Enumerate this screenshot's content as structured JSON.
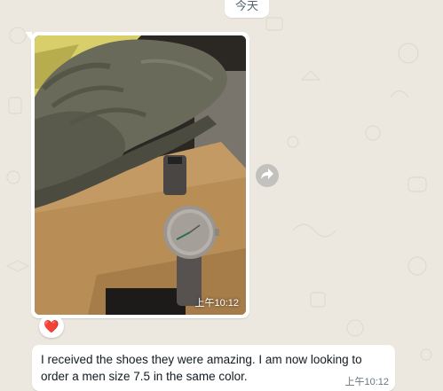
{
  "theme": {
    "chat_background": "#ece8df",
    "bubble": "#ffffff",
    "reaction_heart": "#e0245e"
  },
  "date_chip": {
    "label": "今天"
  },
  "image_message": {
    "time": "上午10:12",
    "reaction": "❤️",
    "forward_icon": "forward-icon",
    "image_description_icon": "photo-shoes-and-watch"
  },
  "text_message": {
    "text": "I received the shoes they were amazing. I am now looking to order a men size 7.5 in the same color.",
    "time": "上午10:12"
  }
}
